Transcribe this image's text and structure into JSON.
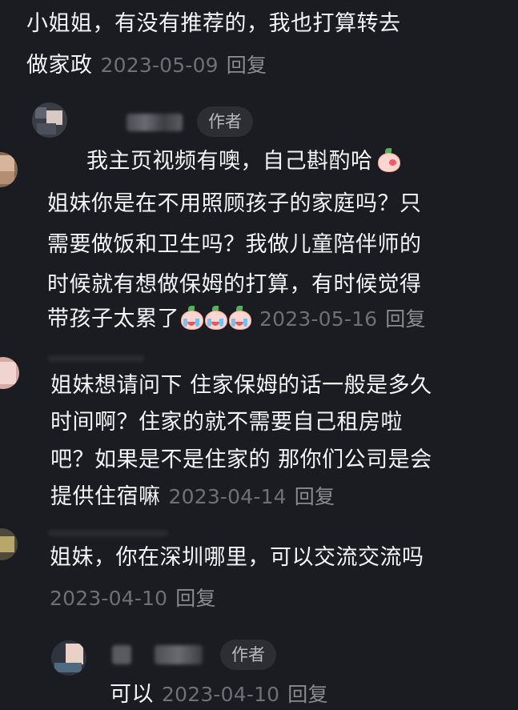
{
  "comments": [
    {
      "lines": [
        "小姐姐，有没有推荐的，我也打算转去",
        "做家政"
      ],
      "date": "2023-05-09",
      "reply_label": "回复"
    },
    {
      "author_tag": "作者",
      "lines": [
        "我主页视频有噢，自己斟酌哈"
      ]
    },
    {
      "lines": [
        "姐妹你是在不用照顾孩子的家庭吗？只",
        "需要做饭和卫生吗？我做儿童陪伴师的",
        "时候就有想做保姆的打算，有时候觉得",
        "带孩子太累了"
      ],
      "date": "2023-05-16",
      "reply_label": "回复"
    },
    {
      "lines": [
        "姐妹想请问下 住家保姆的话一般是多久",
        "时间啊？住家的就不需要自己租房啦",
        "吧？如果是不是住家的 那你们公司是会",
        "提供住宿嘛"
      ],
      "date": "2023-04-14",
      "reply_label": "回复"
    },
    {
      "lines": [
        "姐妹，你在深圳哪里，可以交流交流吗"
      ],
      "date": "2023-04-10",
      "reply_label": "回复"
    },
    {
      "author_tag": "作者",
      "lines": [
        "可以"
      ],
      "date": "2023-04-10",
      "reply_label": "回复"
    }
  ],
  "colors": {
    "background": "#1b1c21",
    "text": "#f4f4f6",
    "meta": "#6f7077",
    "tag_bg": "#2d2e33"
  },
  "icons": {
    "emoji_wink": "peach-wink-emoji",
    "emoji_cry": "peach-cry-emoji"
  }
}
